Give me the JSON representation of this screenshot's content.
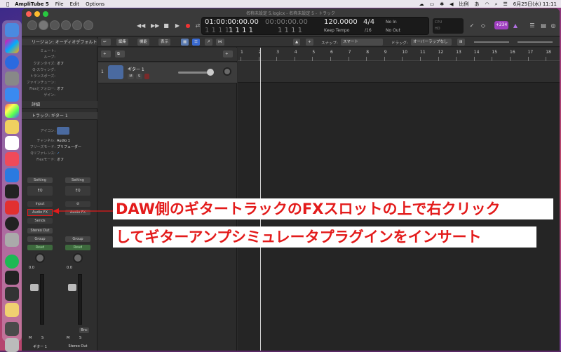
{
  "menubar": {
    "app_name": "AmpliTube 5",
    "items": [
      "File",
      "Edit",
      "Options"
    ],
    "clock": "6月25日(水)  11:11",
    "ime": "比例",
    "kana": "あ"
  },
  "window": {
    "title": "名称未設定 5.logicx - 名称未設定 5 - トラック"
  },
  "transport": {
    "smpte": "01:00:00:00.00",
    "bars": "1  1  1  1",
    "bars_right": "1  1  1  1",
    "bars2": "1  1  1  1",
    "smpte_right": "00:00:00.00",
    "position_right": "1  1  1  1",
    "tempo": "120.0000",
    "tempo_label": "Keep Tempo",
    "sig": "4/4",
    "division": "/16",
    "in": "No In",
    "out": "No Out",
    "badge": "+234",
    "cpu": "CPU",
    "hd": "HD"
  },
  "inspector": {
    "region_section": "リージョン: オーディオデフォルト",
    "region_rows": [
      {
        "k": "ミュート:",
        "v": ""
      },
      {
        "k": "ループ:",
        "v": ""
      },
      {
        "k": "クオンタイズ:",
        "v": "オフ"
      },
      {
        "k": "Q-スウィング:",
        "v": ""
      },
      {
        "k": "トランスポーズ:",
        "v": ""
      },
      {
        "k": "ファインチューン:",
        "v": ""
      },
      {
        "k": "Flexとフォロー:",
        "v": "オフ"
      },
      {
        "k": "ゲイン:",
        "v": ""
      }
    ],
    "detail": "詳細",
    "track_section": "トラック: ギター 1",
    "track_rows": [
      {
        "k": "アイコン:",
        "v": ""
      },
      {
        "k": "チャンネル:",
        "v": "Audio 1"
      },
      {
        "k": "フリーズモード:",
        "v": "プリフェーダー"
      },
      {
        "k": "Qリファレンス:",
        "v": "✓"
      },
      {
        "k": "Flexモード:",
        "v": "オフ"
      }
    ]
  },
  "strip1": {
    "setting": "Setting",
    "eq": "EQ",
    "input": "Input",
    "audiofx": "Audio FX",
    "sends": "Sends",
    "output": "Stereo Out",
    "group": "Group",
    "read": "Read",
    "vol": "0.0",
    "level": "0.0",
    "m": "M",
    "s": "S",
    "name": "ギター 1"
  },
  "strip2": {
    "setting": "Setting",
    "eq": "EQ",
    "audiofx": "Audio FX",
    "group": "Group",
    "read": "Read",
    "vol": "0.0",
    "level": "0.0",
    "bnc": "Bnc",
    "m": "M",
    "s": "S",
    "name": "Stereo Out"
  },
  "toolbar": {
    "edit": "編集",
    "func": "機能",
    "view": "表示",
    "snap_label": "スナップ:",
    "snap_value": "スマート",
    "drag_label": "ドラッグ:",
    "drag_value": "オーバーラップなし"
  },
  "track": {
    "number": "1",
    "name": "ギター 1",
    "m": "M",
    "s": "S"
  },
  "ruler": [
    "1",
    "2",
    "3",
    "4",
    "5",
    "6",
    "7",
    "8",
    "9",
    "10",
    "11",
    "12",
    "13",
    "14",
    "15",
    "16",
    "17",
    "18"
  ],
  "annotation": {
    "line1": "DAW側のギタートラックのFXスロットの上で右クリック",
    "line2": "してギターアンプシミュレータプラグインをインサート"
  },
  "colors": {
    "accent_red": "#e31b1b",
    "panel": "#2b2b2b",
    "read_green": "#4a8a4a"
  }
}
